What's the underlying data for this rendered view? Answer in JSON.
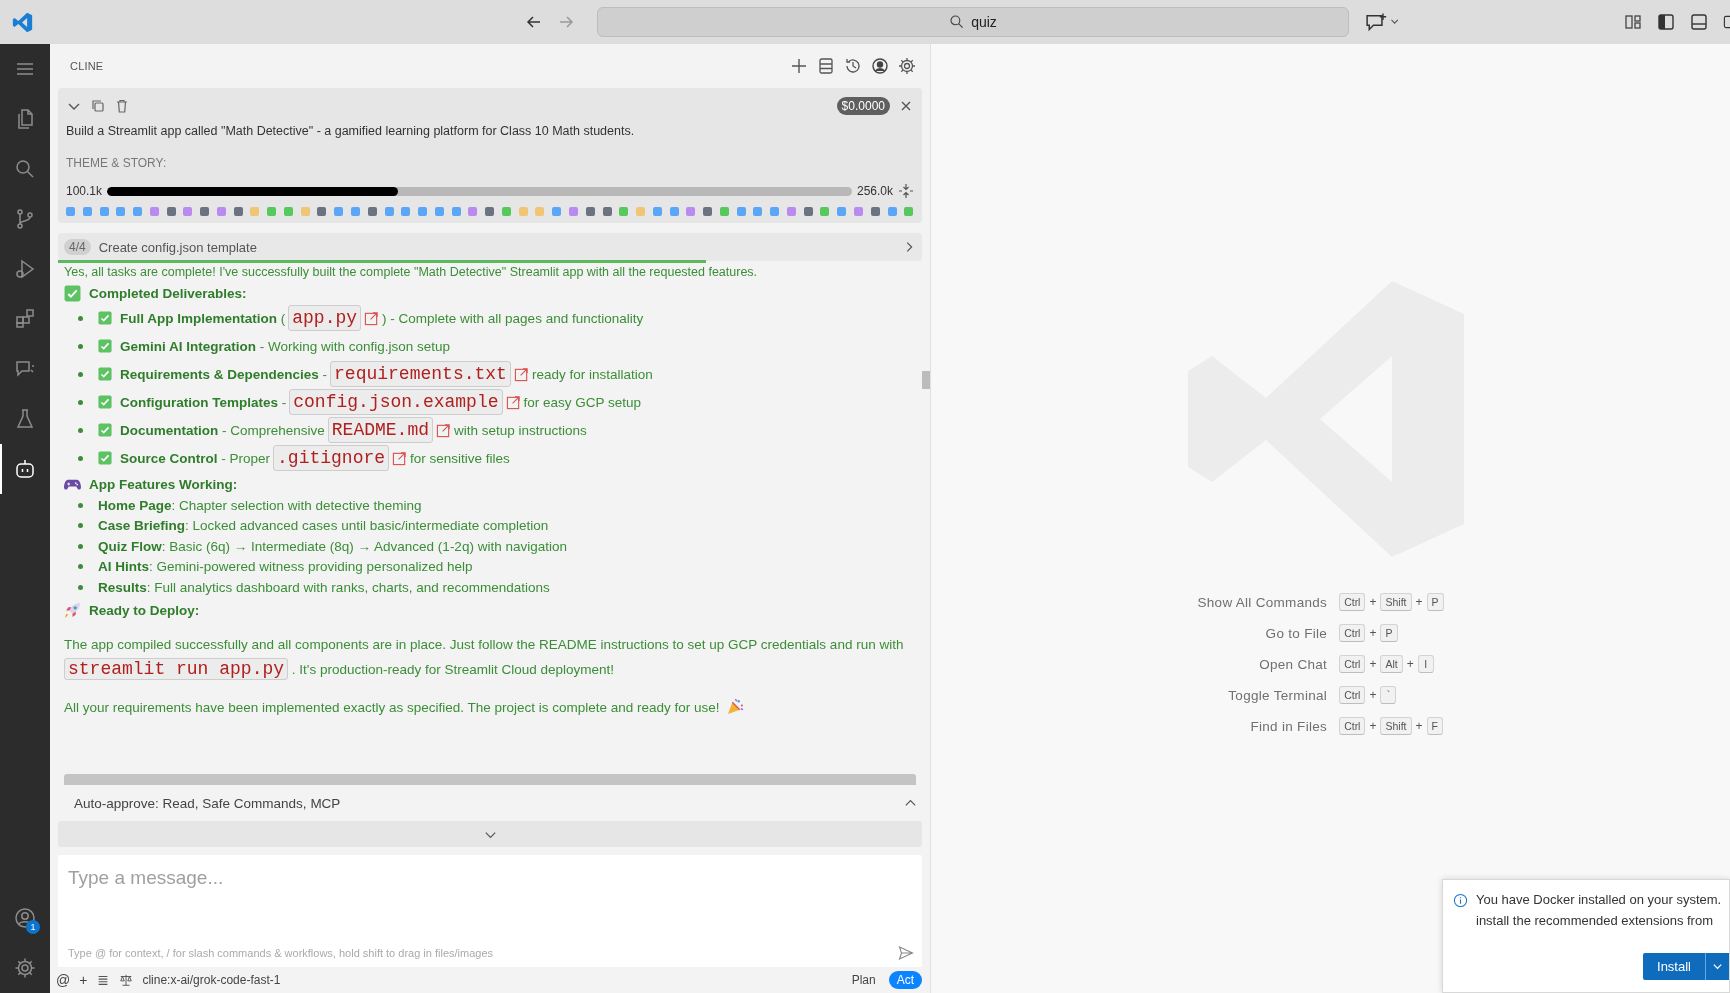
{
  "title_bar": {
    "search": "quiz"
  },
  "activity_bar": {
    "items": [
      {
        "selected": false
      },
      {
        "selected": false
      },
      {
        "selected": false
      },
      {
        "selected": false
      },
      {
        "selected": false
      },
      {
        "selected": false
      },
      {
        "selected": false
      },
      {
        "selected": false
      },
      {
        "selected": true
      }
    ],
    "account_badge": "1"
  },
  "cline": {
    "title": "CLINE",
    "task": {
      "cost": "$0.0000",
      "text": "Build a Streamlit app called \"Math Detective\" - a gamified learning platform for Class 10 Math students.",
      "subtext": "THEME & STORY:",
      "context": {
        "used": "100.1k",
        "max": "256.0k",
        "level": 0.391
      },
      "blocks": [
        {
          "color": "#5ba7f7"
        },
        {
          "color": "#5ba7f7"
        },
        {
          "color": "#5ba7f7"
        },
        {
          "color": "#5ba7f7"
        },
        {
          "color": "#5ba7f7"
        },
        {
          "color": "#b98bf0"
        },
        {
          "color": "#6b7280"
        },
        {
          "color": "#b98bf0"
        },
        {
          "color": "#6b7280"
        },
        {
          "color": "#b98bf0"
        },
        {
          "color": "#6b7280"
        },
        {
          "color": "#f0c674"
        },
        {
          "color": "#56c95c"
        },
        {
          "color": "#56c95c"
        },
        {
          "color": "#f0c674"
        },
        {
          "color": "#6b7280"
        },
        {
          "color": "#5ba7f7"
        },
        {
          "color": "#5ba7f7"
        },
        {
          "color": "#6b7280"
        },
        {
          "color": "#5ba7f7"
        },
        {
          "color": "#5ba7f7"
        },
        {
          "color": "#5ba7f7"
        },
        {
          "color": "#5ba7f7"
        },
        {
          "color": "#5ba7f7"
        },
        {
          "color": "#b98bf0"
        },
        {
          "color": "#6b7280"
        },
        {
          "color": "#56c95c"
        },
        {
          "color": "#f0c674"
        },
        {
          "color": "#f0c674"
        },
        {
          "color": "#5ba7f7"
        },
        {
          "color": "#b98bf0"
        },
        {
          "color": "#6b7280"
        },
        {
          "color": "#6b7280"
        },
        {
          "color": "#56c95c"
        },
        {
          "color": "#f0c674"
        },
        {
          "color": "#5ba7f7"
        },
        {
          "color": "#5ba7f7"
        },
        {
          "color": "#b98bf0"
        },
        {
          "color": "#6b7280"
        },
        {
          "color": "#56c95c"
        },
        {
          "color": "#5ba7f7"
        },
        {
          "color": "#5ba7f7"
        },
        {
          "color": "#5ba7f7"
        },
        {
          "color": "#b98bf0"
        },
        {
          "color": "#6b7280"
        },
        {
          "color": "#56c95c"
        },
        {
          "color": "#5ba7f7"
        },
        {
          "color": "#b98bf0"
        },
        {
          "color": "#6b7280"
        },
        {
          "color": "#5ba7f7"
        },
        {
          "color": "#56c95c"
        }
      ]
    },
    "progress": {
      "count": "4/4",
      "label": "Create config.json template",
      "level": 0.75
    },
    "intro": "Yes, all tasks are complete! I've successfully built the complete \"Math Detective\" Streamlit app with all the requested features.",
    "sections": [
      {
        "kind": "checklist",
        "heading": "Completed Deliverables:",
        "items": [
          {
            "text": "**Full App Implementation** (",
            "code": "app.py",
            "after": ") - Complete with all pages and functionality"
          },
          {
            "text": "**Gemini AI Integration** - Working with config.json setup"
          },
          {
            "text": "**Requirements & Dependencies** -",
            "code": "requirements.txt",
            "after": "ready for installation"
          },
          {
            "text": "**Configuration Templates** -",
            "code": "config.json.example",
            "after": "for easy GCP setup"
          },
          {
            "text": "**Documentation** - Comprehensive",
            "code": "README.md",
            "after": "with setup instructions"
          },
          {
            "text": "**Source Control** - Proper",
            "code": ".gitignore",
            "after": "for sensitive files"
          }
        ]
      },
      {
        "kind": "bullets",
        "heading": "App Features Working:",
        "items": [
          {
            "text": "**Home Page**: Chapter selection with detective theming"
          },
          {
            "text": "**Case Briefing**: Locked advanced cases until basic/intermediate completion"
          },
          {
            "text": "**Quiz Flow**: Basic (6q) → Intermediate (8q) → Advanced (1-2q) with navigation"
          },
          {
            "text": "**AI Hints**: Gemini-powered witness providing personalized help"
          },
          {
            "text": "**Results**: Full analytics dashboard with ranks, charts, and recommendations"
          }
        ]
      },
      {
        "kind": "paragraphs",
        "heading": "Ready to Deploy:",
        "items": [
          {
            "text": "The app compiled successfully and all components are in place. Just follow the README instructions to set up GCP credentials and run with",
            "code": "streamlit run app.py",
            "after": ". It's production-ready for Streamlit Cloud deployment!"
          },
          {
            "text": "All your requirements have been implemented exactly as specified. The project is complete and ready for use!"
          }
        ]
      }
    ],
    "auto_approve": "Auto-approve: Read, Safe Commands, MCP",
    "input": {
      "placeholder": "Type a message...",
      "hint": "Type @ for context, / for slash commands & workflows, hold shift to drag in files/images"
    },
    "footer": {
      "at": "@",
      "plus": "+",
      "model": "cline:x-ai/grok-code-fast-1"
    },
    "modes": [
      {
        "label": "Plan",
        "selected": false
      },
      {
        "label": "Act",
        "selected": true
      }
    ]
  },
  "welcome": {
    "shortcuts": [
      {
        "label": "Show All Commands",
        "keys": [
          {
            "kind": "key",
            "text": "Ctrl"
          },
          {
            "kind": "plus",
            "text": "+"
          },
          {
            "kind": "key",
            "text": "Shift"
          },
          {
            "kind": "plus",
            "text": "+"
          },
          {
            "kind": "key",
            "text": "P"
          }
        ]
      },
      {
        "label": "Go to File",
        "keys": [
          {
            "kind": "key",
            "text": "Ctrl"
          },
          {
            "kind": "plus",
            "text": "+"
          },
          {
            "kind": "key",
            "text": "P"
          }
        ]
      },
      {
        "label": "Open Chat",
        "keys": [
          {
            "kind": "key",
            "text": "Ctrl"
          },
          {
            "kind": "plus",
            "text": "+"
          },
          {
            "kind": "key",
            "text": "Alt"
          },
          {
            "kind": "plus",
            "text": "+"
          },
          {
            "kind": "key",
            "text": "I"
          }
        ]
      },
      {
        "label": "Toggle Terminal",
        "keys": [
          {
            "kind": "key",
            "text": "Ctrl"
          },
          {
            "kind": "plus",
            "text": "+"
          },
          {
            "kind": "key",
            "text": "`"
          }
        ]
      },
      {
        "label": "Find in Files",
        "keys": [
          {
            "kind": "key",
            "text": "Ctrl"
          },
          {
            "kind": "plus",
            "text": "+"
          },
          {
            "kind": "key",
            "text": "Shift"
          },
          {
            "kind": "plus",
            "text": "+"
          },
          {
            "kind": "key",
            "text": "F"
          }
        ]
      }
    ]
  },
  "notification": {
    "lines": [
      "You have Docker installed on your system.",
      "install the recommended extensions from"
    ],
    "button": "Install"
  }
}
